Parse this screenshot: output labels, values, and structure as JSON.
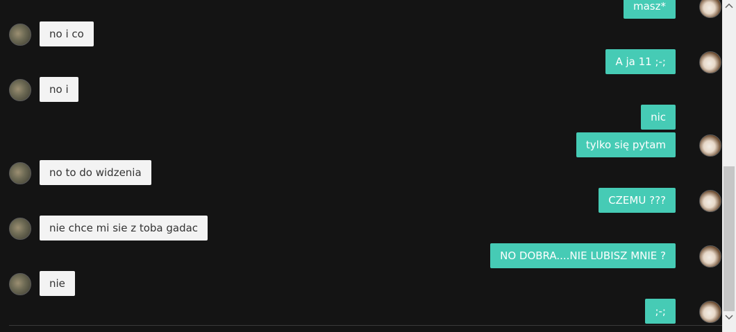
{
  "messages": {
    "out_0": "masz*",
    "in_1": "no i co",
    "out_2": "A ja 11 ;-;",
    "in_3": "no i",
    "out_4": "nic",
    "out_5": "tylko się pytam",
    "in_6": "no to do widzenia",
    "out_7": "CZEMU ???",
    "in_8": "nie chce mi sie z toba gadac",
    "out_9": "NO DOBRA....NIE LUBISZ MNIE ?",
    "in_10": "nie",
    "out_11": ";-;"
  },
  "colors": {
    "background": "#141414",
    "incoming_bubble": "#f3f3f3",
    "outgoing_bubble": "#46cbb5"
  },
  "scrollbar": {
    "up_icon": "chevron-up-icon",
    "down_icon": "chevron-down-icon"
  }
}
